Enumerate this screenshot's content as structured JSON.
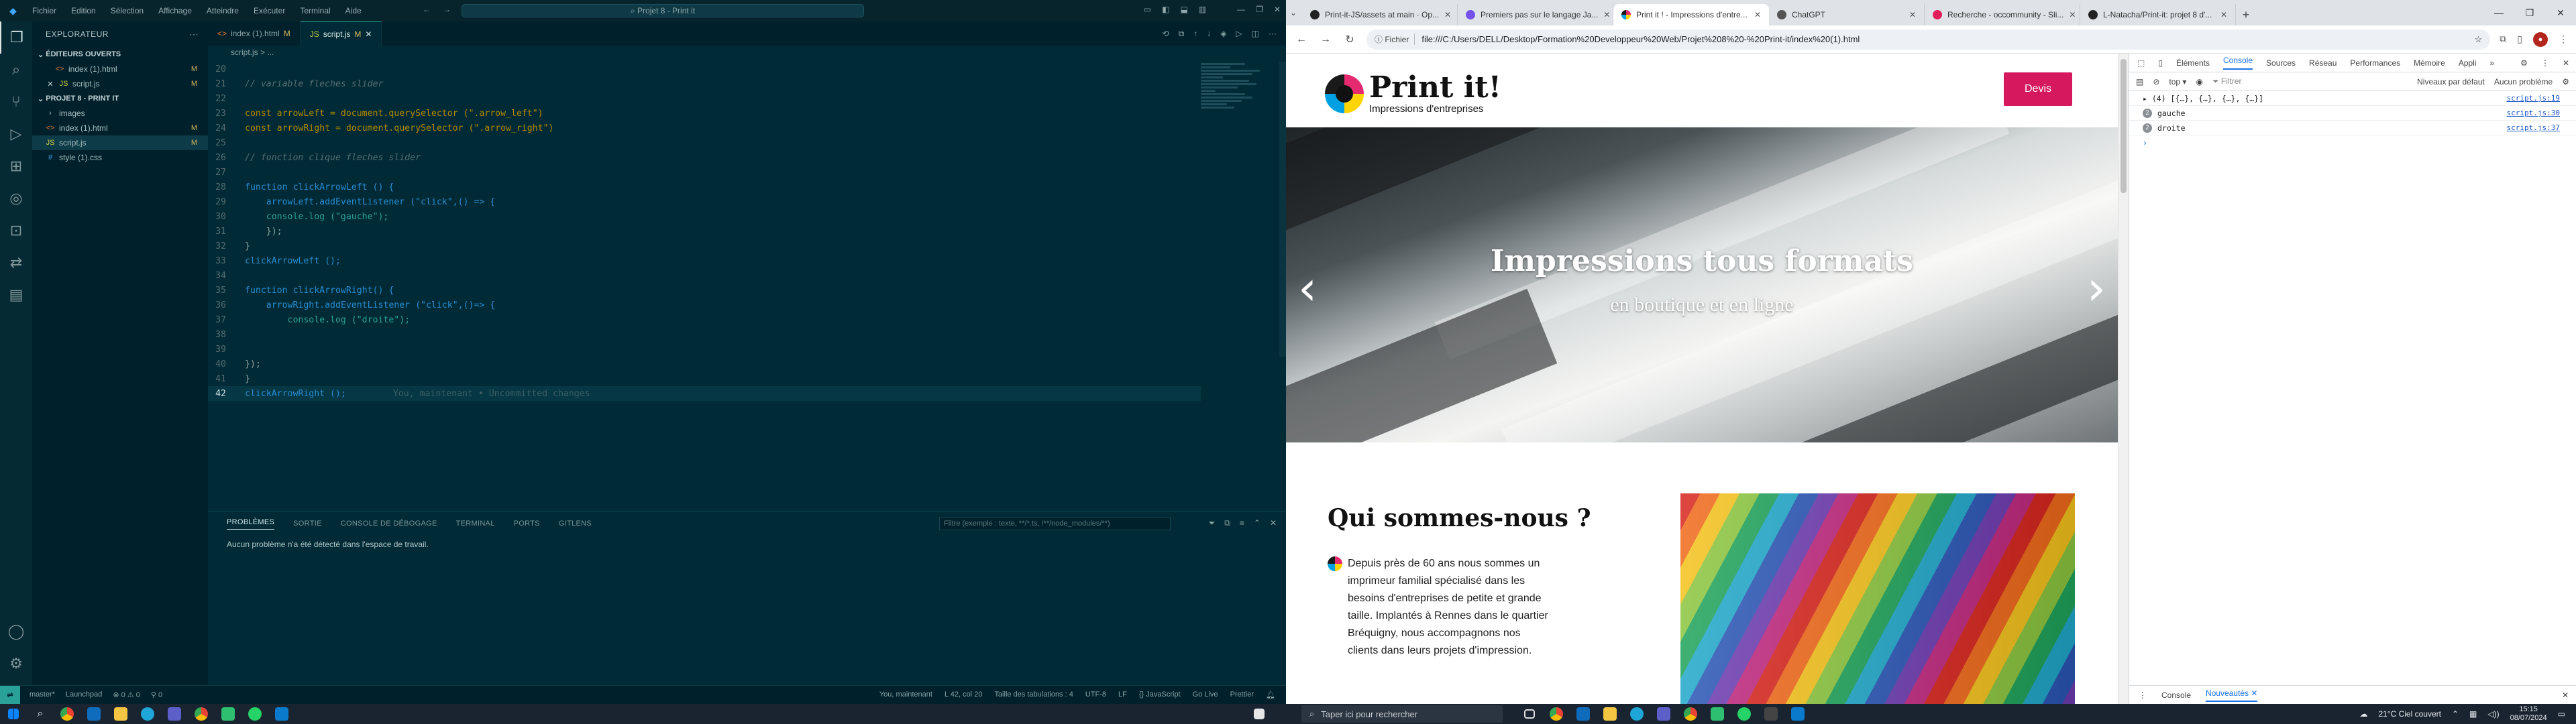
{
  "vscode": {
    "menu": [
      "Fichier",
      "Edition",
      "Sélection",
      "Affichage",
      "Atteindre",
      "Exécuter",
      "Terminal",
      "Aide"
    ],
    "command_center": "Projet 8 - Print it",
    "sidebar": {
      "title": "EXPLORATEUR",
      "open_editors_label": "ÉDITEURS OUVERTS",
      "open_editors": [
        {
          "name": "index (1).html",
          "badge": "M"
        },
        {
          "name": "script.js",
          "badge": "M"
        }
      ],
      "project_label": "PROJET 8 - PRINT IT",
      "files": [
        {
          "name": "images",
          "badge": ""
        },
        {
          "name": "index (1).html",
          "badge": "M"
        },
        {
          "name": "script.js",
          "badge": "M"
        },
        {
          "name": "style (1).css",
          "badge": ""
        }
      ]
    },
    "tabs": [
      {
        "label": "index (1).html",
        "mod": "M"
      },
      {
        "label": "script.js",
        "mod": "M"
      }
    ],
    "breadcrumb": "script.js > ...",
    "code_lines": [
      {
        "n": "20",
        "text": "",
        "cls": ""
      },
      {
        "n": "21",
        "text": "// variable fleches slider",
        "cls": "c-com"
      },
      {
        "n": "22",
        "text": "",
        "cls": ""
      },
      {
        "n": "23",
        "text": "const arrowLeft = document.querySelector (\".arrow_left\")",
        "cls": "c-var"
      },
      {
        "n": "24",
        "text": "const arrowRight = document.querySelector (\".arrow_right\")",
        "cls": "c-var"
      },
      {
        "n": "25",
        "text": "",
        "cls": ""
      },
      {
        "n": "26",
        "text": "// fonction clique fleches slider",
        "cls": "c-com"
      },
      {
        "n": "27",
        "text": "",
        "cls": ""
      },
      {
        "n": "28",
        "text": "function clickArrowLeft () {",
        "cls": "c-fn"
      },
      {
        "n": "29",
        "text": "    arrowLeft.addEventListener (\"click\",() => {",
        "cls": "c-fn"
      },
      {
        "n": "30",
        "text": "    console.log (\"gauche\");",
        "cls": "c-str"
      },
      {
        "n": "31",
        "text": "    });",
        "cls": ""
      },
      {
        "n": "32",
        "text": "}",
        "cls": ""
      },
      {
        "n": "33",
        "text": "clickArrowLeft ();",
        "cls": "c-fn"
      },
      {
        "n": "34",
        "text": "",
        "cls": ""
      },
      {
        "n": "35",
        "text": "function clickArrowRight() {",
        "cls": "c-fn"
      },
      {
        "n": "36",
        "text": "    arrowRight.addEventListener (\"click\",()=> {",
        "cls": "c-fn"
      },
      {
        "n": "37",
        "text": "        console.log (\"droite\");",
        "cls": "c-str"
      },
      {
        "n": "38",
        "text": "",
        "cls": ""
      },
      {
        "n": "39",
        "text": "    ",
        "cls": ""
      },
      {
        "n": "40",
        "text": "});",
        "cls": ""
      },
      {
        "n": "41",
        "text": "}",
        "cls": ""
      },
      {
        "n": "42",
        "text": "clickArrowRight ();",
        "cls": "c-fn"
      }
    ],
    "blame": "You, maintenant • Uncommitted changes",
    "panel_tabs": [
      "PROBLÈMES",
      "SORTIE",
      "CONSOLE DE DÉBOGAGE",
      "TERMINAL",
      "PORTS",
      "GITLENS"
    ],
    "panel_filter_placeholder": "Filtre (exemple : texte, **/*.ts, !**/node_modules/**)",
    "panel_message": "Aucun problème n'a été détecté dans l'espace de travail.",
    "status_left": [
      "master*",
      "Launchpad",
      "⊗ 0 ⚠ 0",
      "⚲ 0"
    ],
    "status_right": [
      "You, maintenant",
      "L 42, col 20",
      "Taille des tabulations : 4",
      "UTF-8",
      "LF",
      "{} JavaScript",
      "Go Live",
      "Prettier"
    ]
  },
  "chrome": {
    "tabs": [
      {
        "label": "Print-it-JS/assets at main · Op...",
        "active": false
      },
      {
        "label": "Premiers pas sur le langage Ja...",
        "active": false
      },
      {
        "label": "Print it ! - Impressions d'entre...",
        "active": true
      },
      {
        "label": "ChatGPT",
        "active": false
      },
      {
        "label": "Recherche - occommunity - Sli...",
        "active": false
      },
      {
        "label": "L-Natacha/Print-it: projet 8 d'...",
        "active": false
      }
    ],
    "address_chip": "Fichier",
    "url": "file:///C:/Users/DELL/Desktop/Formation%20Developpeur%20Web/Projet%208%20-%20Print-it/index%20(1).html",
    "page": {
      "logo_title": "Print it!",
      "logo_subtitle": "Impressions d'entreprises",
      "cta": "Devis",
      "banner_title": "Impressions tous formats",
      "banner_subtitle": "en boutique et en ligne",
      "about_title": "Qui sommes-nous ?",
      "about_text": "Depuis près de 60 ans nous sommes un imprimeur familial spécialisé dans les besoins d'entreprises de petite et grande taille. Implantés à Rennes dans le quartier Bréquigny, nous accompagnons nos clients dans leurs projets d'impression."
    },
    "devtools": {
      "tabs": [
        "Éléments",
        "Console",
        "Sources",
        "Réseau",
        "Performances",
        "Mémoire",
        "Appli"
      ],
      "context": "top",
      "filter_placeholder": "Filtrer",
      "levels": "Niveaux par défaut",
      "issues": "Aucun problème",
      "console": [
        {
          "text": "▸ (4) [{…}, {…}, {…}, {…}]",
          "src": "script.js:19",
          "count": ""
        },
        {
          "text": "gauche",
          "src": "script.js:30",
          "count": "2"
        },
        {
          "text": "droite",
          "src": "script.js:37",
          "count": "2"
        }
      ],
      "drawer_tabs": [
        "Console",
        "Nouveautés"
      ]
    }
  },
  "taskbar": {
    "search_placeholder": "Taper ici pour rechercher",
    "weather": "21°C Ciel couvert",
    "time": "15:15",
    "date": "08/07/2024"
  }
}
